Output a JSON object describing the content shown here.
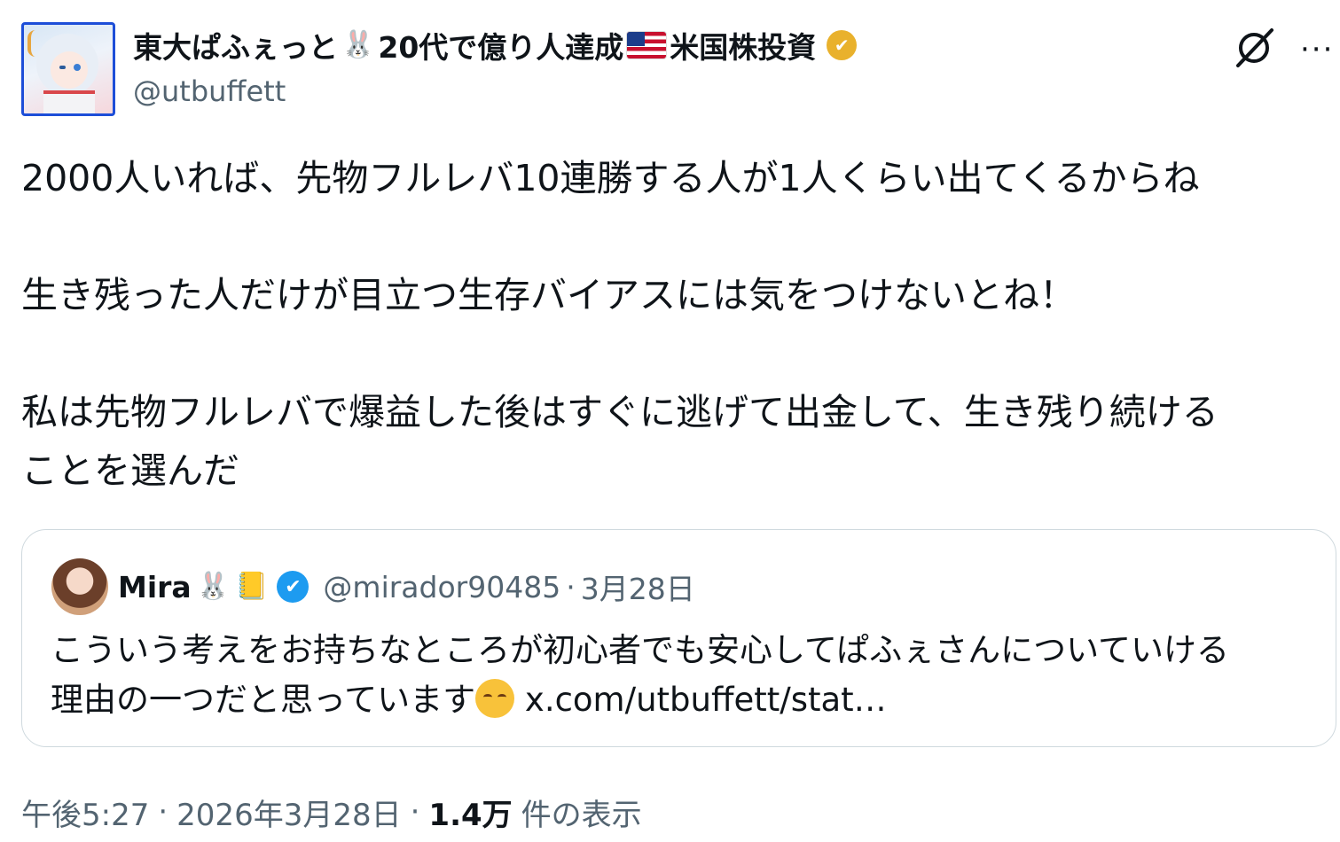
{
  "author": {
    "name": "東大ぱふぇっと",
    "name_suffix": "20代で億り人達成",
    "name_tail": "米国株投資",
    "emoji_rabbit": "🐰",
    "handle": "@utbuffett",
    "verified_badge_color": "#e9b12c"
  },
  "header_icons": [
    "grok-icon",
    "more-icon"
  ],
  "more_label": "···",
  "tweet": {
    "line1": "2000人いれば、先物フルレバ10連勝する人が1人くらい出てくるからね",
    "line2": "生き残った人だけが目立つ生存バイアスには気をつけないとね！",
    "line3a": "私は先物フルレバで爆益した後はすぐに逃げて出金して、生き残り続ける",
    "line3b": "ことを選んだ"
  },
  "quote": {
    "name": "Mira",
    "emoji_rabbit": "🐰",
    "emoji_notebook": "📒",
    "badge_check": "✔",
    "handle": "@mirador90485",
    "separator": "·",
    "date": "3月28日",
    "text_line1": "こういう考えをお持ちなところが初心者でも安心してぱふぇさんについていける",
    "text_line2": "理由の一つだと思っています",
    "link": "x.com/utbuffett/stat…",
    "verified_badge_color": "#1d9bf0"
  },
  "footer": {
    "time": "午後5:27",
    "sep1": "·",
    "date": "2026年3月28日",
    "sep2": "·",
    "views_count": "1.4万",
    "views_label": "件の表示"
  },
  "colors": {
    "text": "#0f1419",
    "secondary": "#536471",
    "border": "#cfd9de",
    "avatar_frame": "#1d4ed8"
  }
}
